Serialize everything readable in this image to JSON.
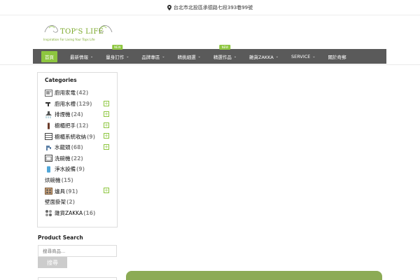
{
  "topbar": {
    "address": "台北市北投區承德路七段393巷99號"
  },
  "logo": {
    "brand": "TOP'S LIFE",
    "tagline": "Inspiration For Living Your Tops Life"
  },
  "nav": {
    "items": [
      {
        "label": "首頁",
        "active": true,
        "has_menu": false,
        "badge": ""
      },
      {
        "label": "最新情報",
        "has_menu": true,
        "badge": ""
      },
      {
        "label": "量身訂作",
        "has_menu": true,
        "badge": "NEW"
      },
      {
        "label": "品牌專區",
        "has_menu": true,
        "badge": ""
      },
      {
        "label": "精挑細選",
        "has_menu": true,
        "badge": ""
      },
      {
        "label": "精選作品",
        "has_menu": true,
        "badge": "NEW"
      },
      {
        "label": "雜貨ZAKKA",
        "has_menu": true,
        "badge": ""
      },
      {
        "label": "SERVICE",
        "has_menu": true,
        "badge": ""
      },
      {
        "label": "關於奇郵",
        "has_menu": false,
        "badge": ""
      }
    ]
  },
  "sidebar": {
    "title": "Categories",
    "categories": [
      {
        "label": "廚用家電",
        "count": "(42)",
        "icon": "appliance-icon",
        "expandable": false
      },
      {
        "label": "廚用水槽",
        "count": "(129)",
        "icon": "faucet-icon",
        "expandable": true
      },
      {
        "label": "排煙機",
        "count": "(24)",
        "icon": "range-hood-icon",
        "expandable": true
      },
      {
        "label": "櫥櫃把手",
        "count": "(12)",
        "icon": "handle-icon",
        "expandable": true
      },
      {
        "label": "櫥櫃系統收納",
        "count": "(9)",
        "icon": "cabinet-icon",
        "expandable": true
      },
      {
        "label": "水龍頭",
        "count": "(68)",
        "icon": "tap-icon",
        "expandable": true
      },
      {
        "label": "洗碗機",
        "count": "(22)",
        "icon": "dishwasher-icon",
        "expandable": false
      },
      {
        "label": "淨水設備",
        "count": "(9)",
        "icon": "water-filter-icon",
        "expandable": false
      },
      {
        "label": "烘碗機",
        "count": "(15)",
        "icon": "",
        "expandable": false
      },
      {
        "label": "爐具",
        "count": "(91)",
        "icon": "stove-icon",
        "expandable": true
      },
      {
        "label": "壁面掛架",
        "count": "(2)",
        "icon": "",
        "expandable": false
      },
      {
        "label": "雜貨ZAKKA",
        "count": "(16)",
        "icon": "zakka-icon",
        "expandable": false
      }
    ]
  },
  "search": {
    "title": "Product Search",
    "placeholder": "搜尋商品...",
    "button": "搜尋"
  },
  "colors": {
    "accent": "#8dc63f",
    "nav_bg": "#5a5a5a",
    "banner": "#8cab55"
  }
}
